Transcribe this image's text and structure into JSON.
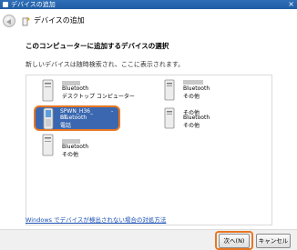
{
  "window": {
    "title": "デバイスの追加"
  },
  "nav": {
    "title": "デバイスの追加"
  },
  "heading": "このコンピューターに追加するデバイスの選択",
  "subtext": "新しいデバイスは随時検索され、ここに表示されます。",
  "devices": [
    {
      "name": "",
      "type": "Bluetooth",
      "category": "デスクトップ コンピューター"
    },
    {
      "name": "SPWN_H36_",
      "name_suffix": "-BT",
      "type": "Bluetooth",
      "category": "電話",
      "selected": true
    },
    {
      "name": "",
      "type": "Bluetooth",
      "category": "その他"
    },
    {
      "name": "",
      "type": "Bluetooth",
      "category": "その他"
    },
    {
      "name": "その他",
      "type": "Bluetooth",
      "category": "その他"
    }
  ],
  "link": "Windows でデバイスが検出されない場合の対処方法",
  "buttons": {
    "next": "次へ(N)",
    "cancel": "キャンセル"
  },
  "window_controls": {
    "close": "×"
  },
  "colors": {
    "highlight": "#e87722",
    "selection": "#3a67b0",
    "link": "#1a4fb4"
  }
}
